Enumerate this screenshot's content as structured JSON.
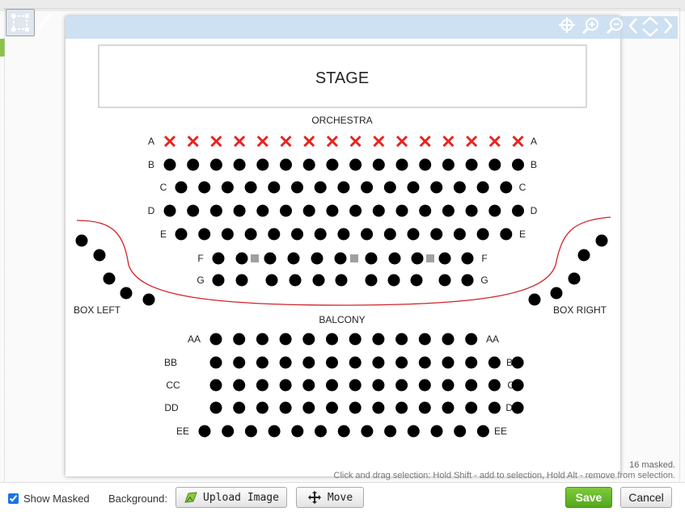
{
  "map": {
    "stage_label": "STAGE",
    "orchestra_label": "ORCHESTRA",
    "balcony_label": "BALCONY",
    "box_left_label": "BOX LEFT",
    "box_right_label": "BOX RIGHT",
    "orchestra_rows": [
      {
        "label": "A",
        "sold": true
      },
      {
        "label": "B",
        "sold": false
      },
      {
        "label": "C",
        "sold": false
      },
      {
        "label": "D",
        "sold": false
      },
      {
        "label": "E",
        "sold": false
      },
      {
        "label": "F",
        "sold": false
      },
      {
        "label": "G",
        "sold": false
      }
    ],
    "balcony_rows": [
      "AA",
      "BB",
      "CC",
      "DD",
      "EE"
    ]
  },
  "colors": {
    "seat": "#000000",
    "sold": "#e8231f",
    "masked": "#a0a0a0",
    "curve": "#d0232a",
    "save_green": "#5cb82a"
  },
  "status": {
    "masked_count": "16 masked.",
    "hint": "Click and drag selection: Hold Shift - add to selection, Hold Alt - remove from selection."
  },
  "bottom": {
    "show_masked_label": "Show Masked",
    "background_label": "Background:",
    "upload_label": "Upload Image",
    "move_label": "Move",
    "save_label": "Save",
    "cancel_label": "Cancel"
  },
  "toolbar_icons": [
    "select-tool-icon",
    "brush-tool-icon",
    "center-target-icon",
    "zoom-in-icon",
    "zoom-out-icon",
    "prev-icon",
    "expand-icon",
    "next-icon"
  ]
}
